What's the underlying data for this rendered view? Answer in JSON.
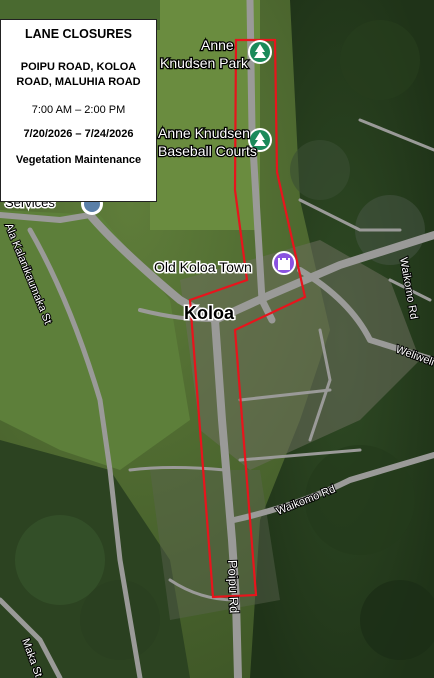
{
  "info": {
    "title": "LANE CLOSURES",
    "roads": "POIPU ROAD, KOLOA ROAD, MALUHIA ROAD",
    "time": "7:00 AM – 2:00 PM",
    "dates": "7/20/2026 – 7/24/2026",
    "reason": "Vegetation Maintenance"
  },
  "map": {
    "places": {
      "park1_line1": "Anne",
      "park1_line2": "Knudsen Park",
      "park2_line1": "Anne Knudsen",
      "park2_line2": "Baseball Courts",
      "old_town": "Old Koloa Town",
      "town": "Koloa",
      "service": "Services"
    },
    "roads": {
      "ala_kalanikaumaka": "Ala Kalanikaumaka St",
      "poipu": "Poipu Rd",
      "waikomo": "Waikomo Rd",
      "weliweli": "Weliweli",
      "waikomo_rd_east": "Waikomo Rd",
      "maka_st": "Maka St"
    },
    "icons": [
      "tree-icon",
      "tree-icon",
      "castle-icon"
    ],
    "closure_color": "#e8141c"
  }
}
